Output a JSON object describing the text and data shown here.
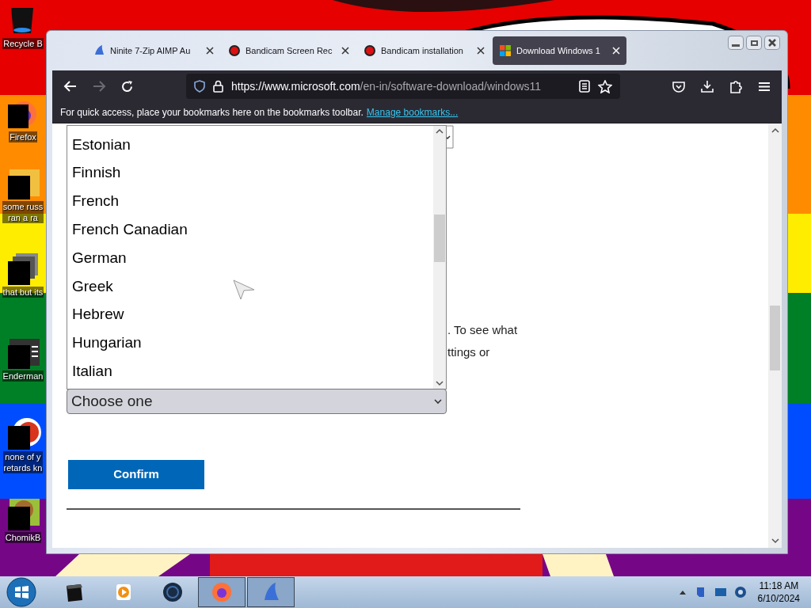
{
  "desktop_icons": [
    {
      "kind": "bin",
      "lines": [
        "Recycle B"
      ]
    },
    {
      "kind": "firefox",
      "lines": [
        "Firefox"
      ]
    },
    {
      "kind": "folder",
      "lines": [
        "some russ",
        "ran a ra"
      ]
    },
    {
      "kind": "stack",
      "lines": [
        "that but its"
      ]
    },
    {
      "kind": "terminal",
      "lines": [
        "Enderman"
      ]
    },
    {
      "kind": "circle",
      "lines": [
        "none of y",
        "retards kn"
      ]
    },
    {
      "kind": "beaver",
      "lines": [
        "ChomikB"
      ]
    }
  ],
  "browser": {
    "tabs": [
      {
        "kind": "shark",
        "label": "Ninite 7-Zip AIMP Au",
        "selected": false
      },
      {
        "kind": "record",
        "label": "Bandicam Screen Rec",
        "selected": false
      },
      {
        "kind": "record",
        "label": "Bandicam installation",
        "selected": false
      },
      {
        "kind": "windows",
        "label": "Download Windows 1",
        "selected": true
      }
    ],
    "url": {
      "host": "https://www.microsoft.com",
      "path": "/en-in/software-download/windows11"
    },
    "bookmarks_bar": {
      "text": "For quick access, place your bookmarks here on the bookmarks toolbar.",
      "link": "Manage bookmarks..."
    },
    "page": {
      "listbox": [
        {
          "label": "Estonian"
        },
        {
          "label": "Finnish"
        },
        {
          "label": "French"
        },
        {
          "label": "French Canadian"
        },
        {
          "label": "German"
        },
        {
          "label": "Greek"
        },
        {
          "label": "Hebrew"
        },
        {
          "label": "Hungarian"
        },
        {
          "label": "Italian"
        }
      ],
      "partial_text": [
        ". To see what",
        "ttings or"
      ],
      "select": {
        "value": "Choose one"
      },
      "button": "Confirm"
    }
  },
  "taskbar": {
    "apps": [
      {
        "kind": "box",
        "active": false
      },
      {
        "kind": "player",
        "active": false
      },
      {
        "kind": "globe",
        "active": false
      },
      {
        "kind": "firefox",
        "active": true
      },
      {
        "kind": "shark",
        "active": true
      }
    ],
    "clock": {
      "time": "11:18 AM",
      "date": "6/10/2024"
    }
  }
}
